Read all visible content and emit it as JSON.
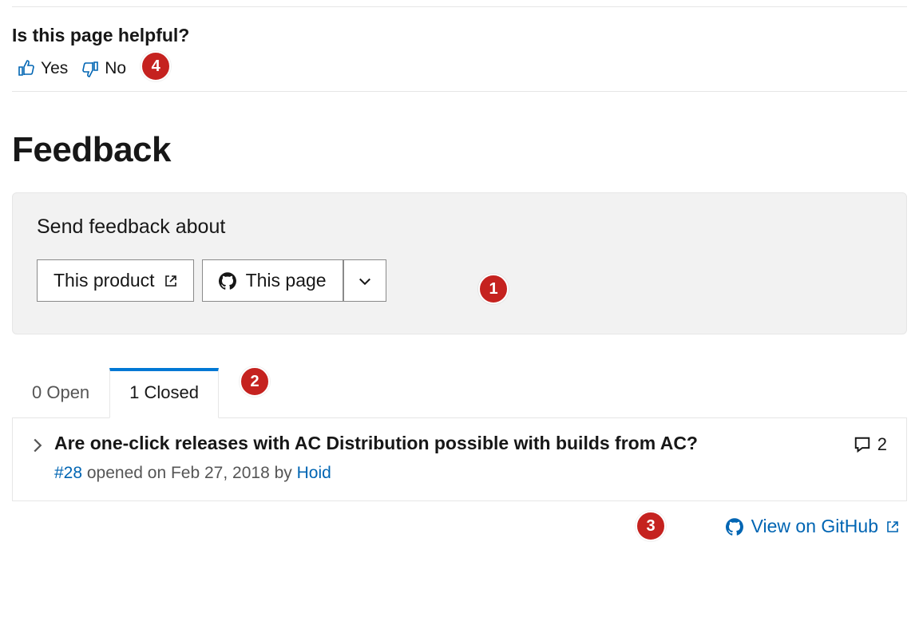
{
  "helpful": {
    "heading": "Is this page helpful?",
    "yes_label": "Yes",
    "no_label": "No"
  },
  "feedback": {
    "heading": "Feedback",
    "send_label": "Send feedback about",
    "product_button": "This product",
    "page_button": "This page"
  },
  "tabs": {
    "open": "0 Open",
    "closed": "1 Closed"
  },
  "issue": {
    "title": "Are one-click releases with AC Distribution possible with builds from AC?",
    "number": "#28",
    "meta_mid": " opened on Feb 27, 2018 by ",
    "author": "Hoid",
    "comments": "2"
  },
  "footer": {
    "view_label": "View on GitHub"
  },
  "markers": {
    "m1": "1",
    "m2": "2",
    "m3": "3",
    "m4": "4"
  }
}
